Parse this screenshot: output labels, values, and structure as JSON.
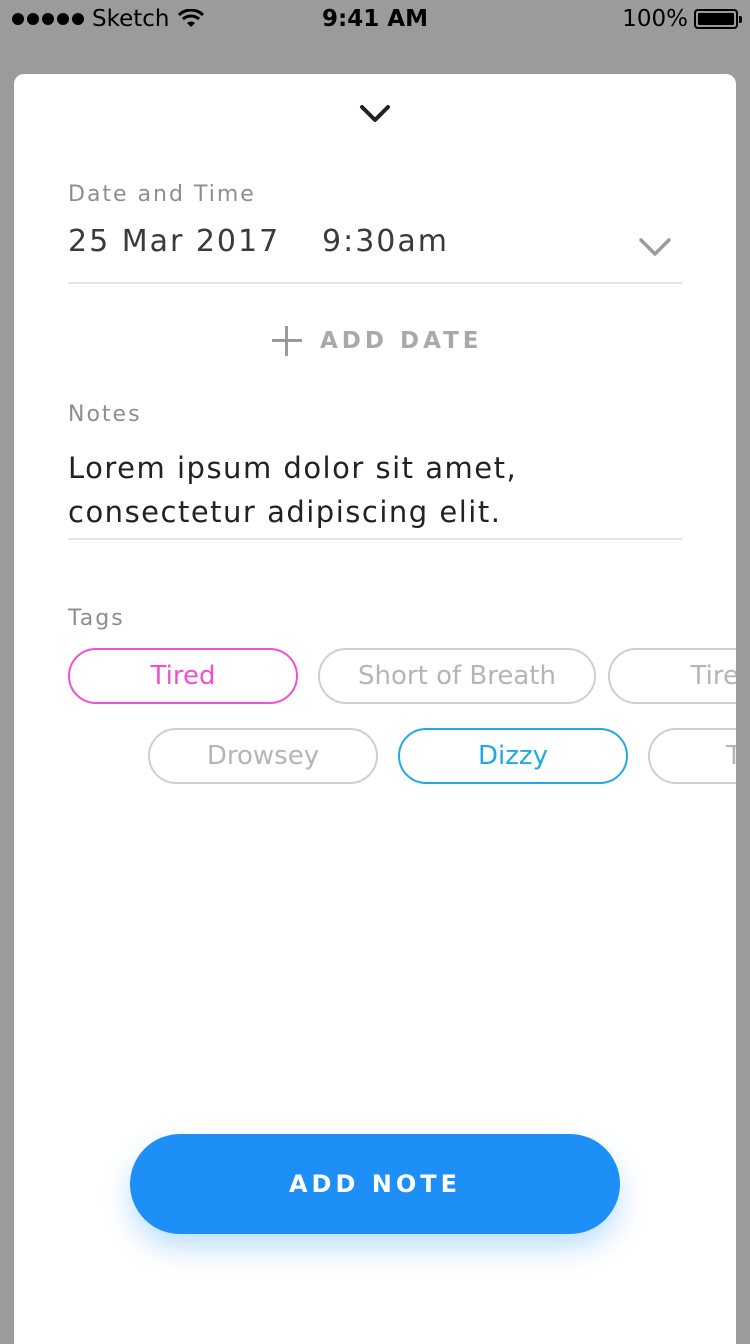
{
  "status_bar": {
    "carrier": "Sketch",
    "time": "9:41 AM",
    "battery_text": "100%",
    "battery_level": 1.0
  },
  "sheet": {
    "collapse_icon": "chevron-down-icon"
  },
  "date_time": {
    "label": "Date and Time",
    "date": "25 Mar 2017",
    "time": "9:30am",
    "dropdown_icon": "chevron-down-icon"
  },
  "add_date": {
    "icon": "plus-icon",
    "label": "ADD DATE"
  },
  "notes": {
    "label": "Notes",
    "value": "Lorem ipsum dolor sit amet, consectetur adipiscing elit."
  },
  "tags": {
    "label": "Tags",
    "items": [
      {
        "label": "Tired",
        "state": "selected-pink"
      },
      {
        "label": "Short of Breath",
        "state": "unselected"
      },
      {
        "label": "Tired",
        "state": "unselected"
      },
      {
        "label": "Drowsey",
        "state": "unselected"
      },
      {
        "label": "Dizzy",
        "state": "selected-blue"
      },
      {
        "label": "Ti",
        "state": "unselected"
      }
    ]
  },
  "add_note_button": {
    "label": "ADD NOTE"
  },
  "colors": {
    "accent_blue": "#1d8ff7",
    "tag_pink": "#f04fd2",
    "tag_blue": "#1fa9e6"
  }
}
